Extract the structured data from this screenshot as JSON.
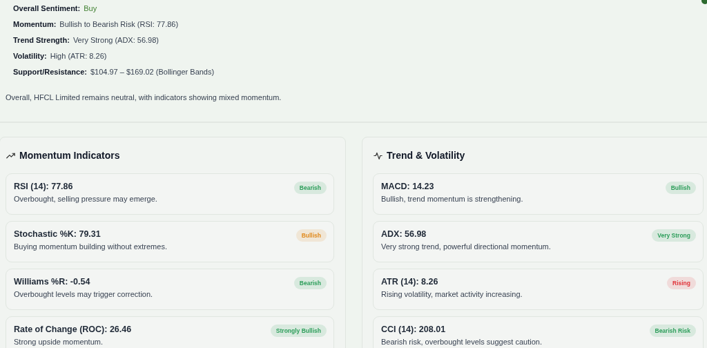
{
  "summary": [
    {
      "label": "Overall Sentiment:",
      "value": "Buy",
      "kind": "signal"
    },
    {
      "label": "Momentum:",
      "value": "Bullish to Bearish Risk (RSI: 77.86)",
      "kind": "plain"
    },
    {
      "label": "Trend Strength:",
      "value": "Very Strong (ADX: 56.98)",
      "kind": "plain"
    },
    {
      "label": "Volatility:",
      "value": "High (ATR: 8.26)",
      "kind": "plain"
    },
    {
      "label": "Support/Resistance:",
      "value": "$104.97 – $169.02 (Bollinger Bands)",
      "kind": "plain"
    }
  ],
  "conclusion": "Overall, HFCL Limited remains neutral, with indicators showing mixed momentum.",
  "panels": [
    {
      "title": "Momentum Indicators",
      "kind": "trend",
      "cards": [
        {
          "title": "RSI (14): 77.86",
          "text": "Overbought, selling pressure may emerge.",
          "badge": "Bearish",
          "color": "#2e9e5b"
        },
        {
          "title": "Stochastic %K: 79.31",
          "text": "Buying momentum building without extremes.",
          "badge": "Bullish",
          "color": "#e08a1e"
        },
        {
          "title": "Williams %R: -0.54",
          "text": "Overbought levels may trigger correction.",
          "badge": "Bearish",
          "color": "#2e9e5b"
        },
        {
          "title": "Rate of Change (ROC): 26.46",
          "text": "Strong upside momentum.",
          "badge": "Strongly Bullish",
          "color": "#2e9e5b"
        }
      ]
    },
    {
      "title": "Trend & Volatility",
      "kind": "pulse",
      "cards": [
        {
          "title": "MACD: 14.23",
          "text": "Bullish, trend momentum is strengthening.",
          "badge": "Bullish",
          "color": "#2e9e5b"
        },
        {
          "title": "ADX: 56.98",
          "text": "Very strong trend, powerful directional momentum.",
          "badge": "Very Strong",
          "color": "#2e9e5b"
        },
        {
          "title": "ATR (14): 8.26",
          "text": "Rising volatility, market activity increasing.",
          "badge": "Rising",
          "color": "#e0343a"
        },
        {
          "title": "CCI (14): 208.01",
          "text": "Bearish risk, overbought levels suggest caution.",
          "badge": "Bearish Risk",
          "color": "#2e9e5b"
        }
      ]
    }
  ]
}
